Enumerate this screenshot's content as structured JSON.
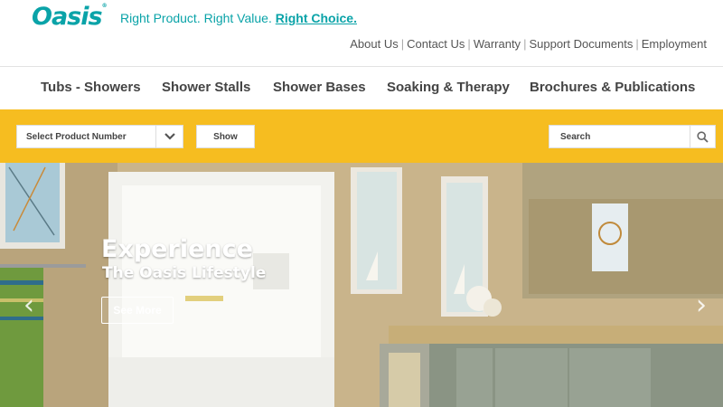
{
  "brand": {
    "logo": "Oasis",
    "tm": "®"
  },
  "tagline": {
    "part1": "Right Product. Right Value.",
    "part2": "Right Choice."
  },
  "utility_nav": [
    "About Us",
    "Contact Us",
    "Warranty",
    "Support Documents",
    "Employment"
  ],
  "main_nav": [
    "Tubs - Showers",
    "Shower Stalls",
    "Shower Bases",
    "Soaking & Therapy",
    "Brochures & Publications"
  ],
  "toolbar": {
    "select_label": "Select Product Number",
    "show_label": "Show",
    "search_placeholder": "Search"
  },
  "hero": {
    "title": "Experience",
    "subtitle": "The Oasis Lifestyle",
    "button": "See More",
    "prev": "‹",
    "next": "›"
  },
  "colors": {
    "accent": "#0aa3a8",
    "toolbar": "#f6bd20"
  }
}
